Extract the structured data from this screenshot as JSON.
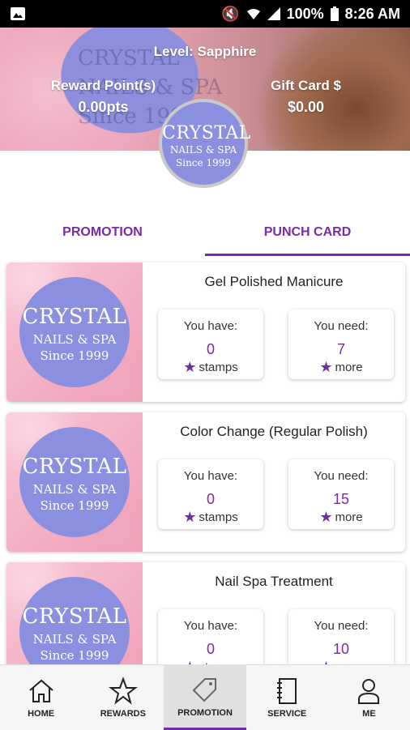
{
  "status": {
    "battery": "100%",
    "time": "8:26 AM"
  },
  "header": {
    "level": "Level: Sapphire",
    "reward_label": "Reward Point(s)",
    "reward_value": "0.00pts",
    "gift_label": "Gift Card $",
    "gift_value": "$0.00",
    "logo": {
      "line1": "CRYSTAL",
      "line2": "NAILS & SPA",
      "line3": "Since 1999"
    }
  },
  "tabs": [
    {
      "label": "PROMOTION",
      "active": false
    },
    {
      "label": "PUNCH CARD",
      "active": true
    }
  ],
  "punch_cards": [
    {
      "title": "Gel Polished Manicure",
      "have_label": "You have:",
      "have_value": "0",
      "have_unit": "stamps",
      "need_label": "You need:",
      "need_value": "7",
      "need_unit": "more"
    },
    {
      "title": "Color Change (Regular Polish)",
      "have_label": "You have:",
      "have_value": "0",
      "have_unit": "stamps",
      "need_label": "You need:",
      "need_value": "15",
      "need_unit": "more"
    },
    {
      "title": "Nail Spa Treatment",
      "have_label": "You have:",
      "have_value": "0",
      "have_unit": "stamps",
      "need_label": "You need:",
      "need_value": "10",
      "need_unit": "more"
    }
  ],
  "card_logo": {
    "line1": "CRYSTAL",
    "line2": "NAILS & SPA",
    "line3": "Since 1999"
  },
  "nav": [
    {
      "label": "HOME",
      "icon": "home-icon"
    },
    {
      "label": "REWARDS",
      "icon": "star-icon"
    },
    {
      "label": "PROMOTION",
      "icon": "tag-icon",
      "active": true
    },
    {
      "label": "SERVICE",
      "icon": "notebook-icon"
    },
    {
      "label": "ME",
      "icon": "person-icon"
    }
  ],
  "colors": {
    "accent": "#7a2aa8",
    "logo_purple": "#8b8fe0"
  }
}
